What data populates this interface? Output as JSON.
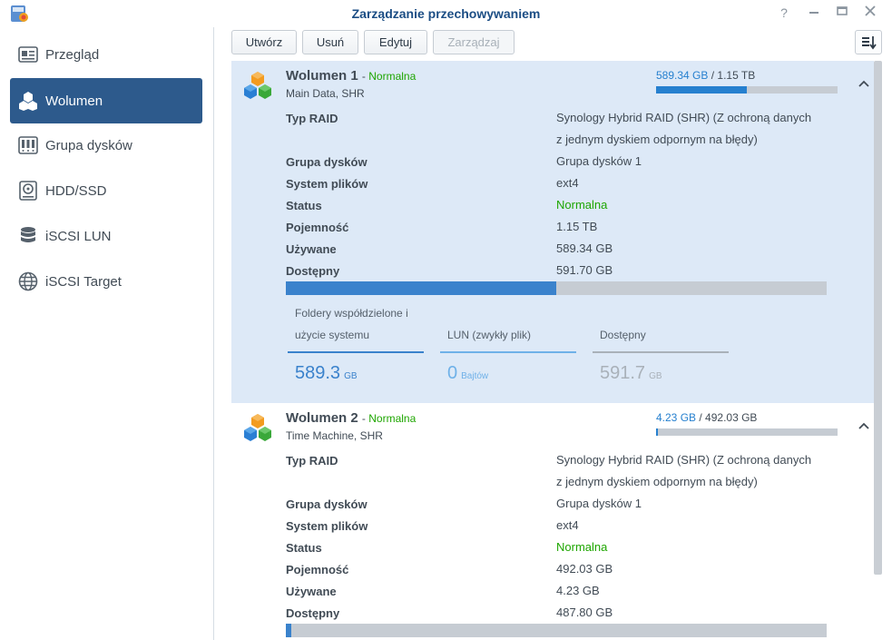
{
  "window": {
    "title": "Zarządzanie przechowywaniem",
    "help_glyph": "?"
  },
  "sidebar": {
    "items": [
      {
        "label": "Przegląd",
        "icon": "overview-card-icon"
      },
      {
        "label": "Wolumen",
        "icon": "cubes-icon",
        "active": true
      },
      {
        "label": "Grupa dysków",
        "icon": "disk-group-icon"
      },
      {
        "label": "HDD/SSD",
        "icon": "hdd-icon"
      },
      {
        "label": "iSCSI LUN",
        "icon": "database-icon"
      },
      {
        "label": "iSCSI Target",
        "icon": "globe-icon"
      }
    ]
  },
  "toolbar": {
    "create": "Utwórz",
    "delete": "Usuń",
    "edit": "Edytuj",
    "manage": "Zarządzaj",
    "sort_icon": "sort-icon"
  },
  "volumes": [
    {
      "name": "Wolumen 1",
      "status": "Normalna",
      "subtitle": "Main Data, SHR",
      "used_text": "589.34 GB",
      "total_text": "1.15 TB",
      "usage_fraction": 0.5,
      "details": {
        "raid_label": "Typ RAID",
        "raid_value_line1": "Synology Hybrid RAID (SHR) (Z ochroną danych",
        "raid_value_line2": "z jednym dyskiem odpornym na błędy)",
        "group_label": "Grupa dysków",
        "group_value": "Grupa dysków 1",
        "fs_label": "System plików",
        "fs_value": "ext4",
        "status_label": "Status",
        "status_value": "Normalna",
        "capacity_label": "Pojemność",
        "capacity_value": "1.15 TB",
        "used_label": "Używane",
        "used_value": "589.34 GB",
        "avail_label": "Dostępny",
        "avail_value": "591.70 GB"
      },
      "legend": {
        "shared_label_line1": "Foldery współdzielone i",
        "shared_label_line2": "użycie systemu",
        "shared_value": "589.3",
        "shared_unit": "GB",
        "lun_label": "LUN (zwykły plik)",
        "lun_value": "0",
        "lun_unit": "Bajtów",
        "avail_label": "Dostępny",
        "avail_value": "591.7",
        "avail_unit": "GB"
      }
    },
    {
      "name": "Wolumen 2",
      "status": "Normalna",
      "subtitle": "Time Machine, SHR",
      "used_text": "4.23 GB",
      "total_text": "492.03 GB",
      "usage_fraction": 0.0086,
      "details": {
        "raid_label": "Typ RAID",
        "raid_value_line1": "Synology Hybrid RAID (SHR) (Z ochroną danych",
        "raid_value_line2": "z jednym dyskiem odpornym na błędy)",
        "group_label": "Grupa dysków",
        "group_value": "Grupa dysków 1",
        "fs_label": "System plików",
        "fs_value": "ext4",
        "status_label": "Status",
        "status_value": "Normalna",
        "capacity_label": "Pojemność",
        "capacity_value": "492.03 GB",
        "used_label": "Używane",
        "used_value": "4.23 GB",
        "avail_label": "Dostępny",
        "avail_value": "487.80 GB"
      }
    }
  ],
  "colors": {
    "accent": "#2680cf",
    "status_green": "#1ea600",
    "sidebar_active": "#2d5a8c",
    "selected_row": "#dde9f7"
  }
}
